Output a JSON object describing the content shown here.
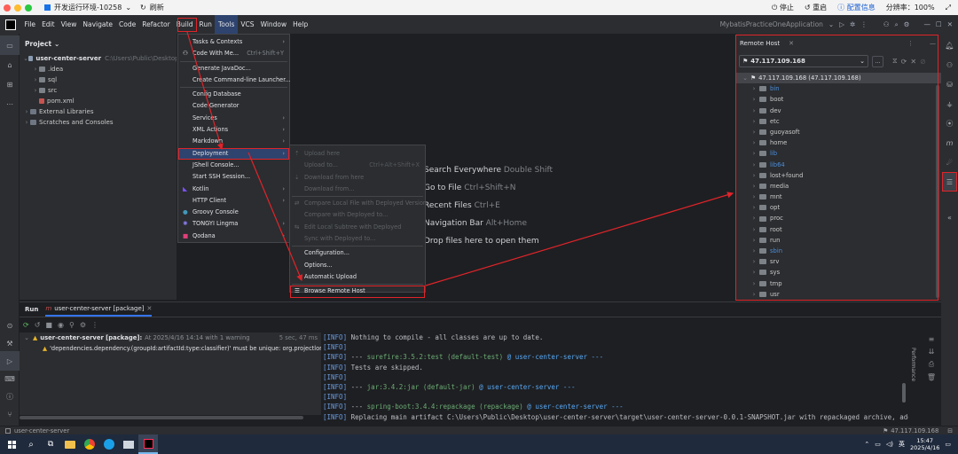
{
  "remote_desktop": {
    "title": "开发运行环境-10258",
    "refresh": "刷新",
    "stop": "停止",
    "restart": "重启",
    "config": "配置信息",
    "resolution": "分辨率：100%"
  },
  "menubar": {
    "items": [
      "File",
      "Edit",
      "View",
      "Navigate",
      "Code",
      "Refactor",
      "Build",
      "Run",
      "Tools",
      "VCS",
      "Window",
      "Help"
    ],
    "run_config": "MybatisPracticeOneApplication"
  },
  "project": {
    "header": "Project",
    "root": "user-center-server",
    "root_path": "C:\\Users\\Public\\Desktop\\user-c",
    "children": [
      ".idea",
      "sql",
      "src",
      "pom.xml"
    ],
    "extra": [
      "External Libraries",
      "Scratches and Consoles"
    ]
  },
  "editor_hints": [
    {
      "text": "Search Everywhere",
      "key": "Double Shift"
    },
    {
      "text": "Go to File",
      "key": "Ctrl+Shift+N"
    },
    {
      "text": "Recent Files",
      "key": "Ctrl+E"
    },
    {
      "text": "Navigation Bar",
      "key": "Alt+Home"
    },
    {
      "text": "Drop files here to open them",
      "key": ""
    }
  ],
  "tools_menu": [
    {
      "label": "Tasks & Contexts",
      "shortcut": "",
      "submenu": true
    },
    {
      "label": "Code With Me...",
      "shortcut": "Ctrl+Shift+Y",
      "submenu": false
    },
    {
      "label": "Generate JavaDoc...",
      "shortcut": "",
      "submenu": false
    },
    {
      "label": "Create Command-line Launcher...",
      "shortcut": "",
      "submenu": false
    },
    {
      "label": "Config Database",
      "shortcut": "",
      "submenu": false
    },
    {
      "label": "Code Generator",
      "shortcut": "",
      "submenu": false
    },
    {
      "label": "Services",
      "shortcut": "",
      "submenu": true
    },
    {
      "label": "XML Actions",
      "shortcut": "",
      "submenu": true
    },
    {
      "label": "Markdown",
      "shortcut": "",
      "submenu": true
    },
    {
      "label": "Deployment",
      "shortcut": "",
      "submenu": true
    },
    {
      "label": "JShell Console...",
      "shortcut": "",
      "submenu": false
    },
    {
      "label": "Start SSH Session...",
      "shortcut": "",
      "submenu": false
    },
    {
      "label": "Kotlin",
      "shortcut": "",
      "submenu": true
    },
    {
      "label": "HTTP Client",
      "shortcut": "",
      "submenu": true
    },
    {
      "label": "Groovy Console",
      "shortcut": "",
      "submenu": false
    },
    {
      "label": "TONGYI Lingma",
      "shortcut": "",
      "submenu": true
    },
    {
      "label": "Qodana",
      "shortcut": "",
      "submenu": true
    }
  ],
  "deployment_menu": [
    {
      "label": "Upload here",
      "shortcut": "",
      "disabled": true
    },
    {
      "label": "Upload to...",
      "shortcut": "Ctrl+Alt+Shift+X",
      "disabled": true
    },
    {
      "label": "Download from here",
      "shortcut": "",
      "disabled": true
    },
    {
      "label": "Download from...",
      "shortcut": "",
      "disabled": true
    },
    {
      "label": "Compare Local File with Deployed Version",
      "shortcut": "",
      "disabled": true
    },
    {
      "label": "Compare with Deployed to...",
      "shortcut": "",
      "disabled": true
    },
    {
      "label": "Edit Local Subtree with Deployed",
      "shortcut": "",
      "disabled": true
    },
    {
      "label": "Sync with Deployed to...",
      "shortcut": "",
      "disabled": true
    },
    {
      "label": "Configuration...",
      "shortcut": "",
      "disabled": false
    },
    {
      "label": "Options...",
      "shortcut": "",
      "disabled": false
    },
    {
      "label": "Automatic Upload",
      "shortcut": "",
      "disabled": false
    },
    {
      "label": "Browse Remote Host",
      "shortcut": "",
      "disabled": false
    }
  ],
  "remote_host": {
    "tab": "Remote Host",
    "server": "47.117.109.168",
    "root": "47.117.109.168 (47.117.109.168)",
    "dirs": [
      {
        "name": "bin",
        "link": true
      },
      {
        "name": "boot",
        "link": false
      },
      {
        "name": "dev",
        "link": false
      },
      {
        "name": "etc",
        "link": false
      },
      {
        "name": "guoyasoft",
        "link": false
      },
      {
        "name": "home",
        "link": false
      },
      {
        "name": "lib",
        "link": true
      },
      {
        "name": "lib64",
        "link": true
      },
      {
        "name": "lost+found",
        "link": false
      },
      {
        "name": "media",
        "link": false
      },
      {
        "name": "mnt",
        "link": false
      },
      {
        "name": "opt",
        "link": false
      },
      {
        "name": "proc",
        "link": false
      },
      {
        "name": "root",
        "link": false
      },
      {
        "name": "run",
        "link": false
      },
      {
        "name": "sbin",
        "link": true
      },
      {
        "name": "srv",
        "link": false
      },
      {
        "name": "sys",
        "link": false
      },
      {
        "name": "tmp",
        "link": false
      },
      {
        "name": "usr",
        "link": false
      }
    ]
  },
  "run": {
    "tab": "Run",
    "config": "user-center-server [package]",
    "summary_title": "user-center-server [package]:",
    "summary_detail": "At 2025/4/16 14:14 with 1 warning",
    "duration": "5 sec, 47 ms",
    "warning": "'dependencies.dependency.(groupId:artifactId:type:classifier)' must be unique: org.projectlombok:lombok",
    "console": [
      {
        "tag": "[INFO]",
        "text": " Nothing to compile - all classes are up to date.",
        "extra": "",
        "extra2": ""
      },
      {
        "tag": "[INFO]",
        "text": "",
        "extra": "",
        "extra2": ""
      },
      {
        "tag": "[INFO]",
        "text": " --- ",
        "extra": "surefire:3.5.2:test (default-test)",
        "extra2": " @ user-center-server ---"
      },
      {
        "tag": "[INFO]",
        "text": " Tests are skipped.",
        "extra": "",
        "extra2": ""
      },
      {
        "tag": "[INFO]",
        "text": "",
        "extra": "",
        "extra2": ""
      },
      {
        "tag": "[INFO]",
        "text": " --- ",
        "extra": "jar:3.4.2:jar (default-jar)",
        "extra2": " @ user-center-server ---"
      },
      {
        "tag": "[INFO]",
        "text": "",
        "extra": "",
        "extra2": ""
      },
      {
        "tag": "[INFO]",
        "text": " --- ",
        "extra": "spring-boot:3.4.4:repackage (repackage)",
        "extra2": " @ user-center-server ---"
      },
      {
        "tag": "[INFO]",
        "text": " Replacing main artifact C:\\Users\\Public\\Desktop\\user-center-server\\target\\user-center-server-0.0.1-SNAPSHOT.jar with repackaged archive, adding nested dep",
        "extra": "",
        "extra2": ""
      }
    ],
    "performance": "Performance"
  },
  "status": {
    "left": "user-center-server",
    "right": "47.117.109.168"
  },
  "taskbar": {
    "time": "15:47",
    "date": "2025/4/16",
    "lang": "英"
  }
}
